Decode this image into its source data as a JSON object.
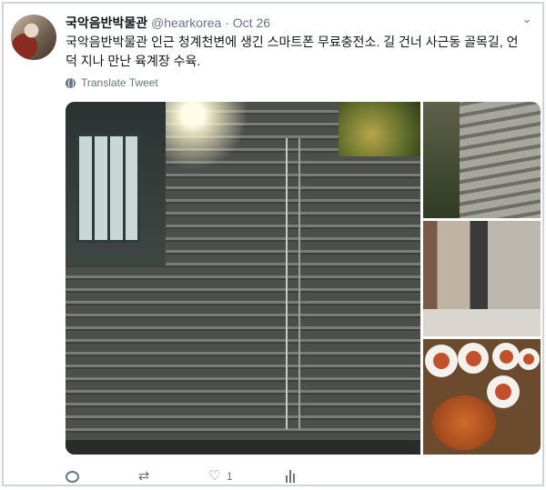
{
  "tweet": {
    "display_name": "국악음반박물관",
    "handle": "@hearkorea",
    "separator": "·",
    "date": "Oct 26",
    "text": "국악음반박물관 인근 청계천변에 생긴 스마트폰 무료충전소. 길 건너 사근동 골목길, 언덕 지나 만난 육계장 수육.",
    "translate_label": "Translate Tweet",
    "media": [
      {
        "name": "stairs-photo",
        "description": "stairway with handrail and phone charging booth"
      },
      {
        "name": "stone-steps-photo"
      },
      {
        "name": "alley-photo"
      },
      {
        "name": "food-photo"
      }
    ]
  },
  "actions": {
    "reply_count": "",
    "retweet_count": "",
    "like_count": "1"
  },
  "icons": {
    "reply": "reply-icon",
    "retweet": "retweet-icon",
    "like": "heart-icon",
    "analytics": "analytics-icon",
    "caret": "chevron-down-icon",
    "translate": "globe-icon"
  },
  "colors": {
    "text": "#14171a",
    "secondary": "#657786"
  }
}
